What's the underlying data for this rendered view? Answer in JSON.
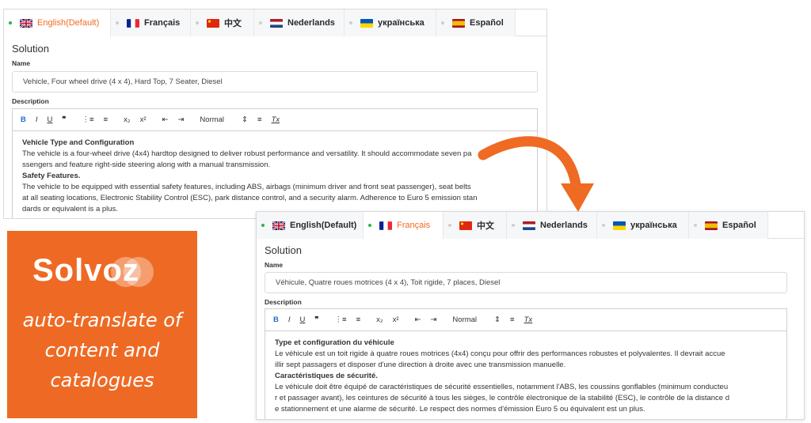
{
  "colors": {
    "accent": "#f26a21",
    "active_dot": "#2db34a",
    "promo_bg": "#ee6a24",
    "arrow": "#ef6a23"
  },
  "tabs": [
    {
      "label": "English(Default)",
      "flag": "uk-flag-icon"
    },
    {
      "label": "Français",
      "flag": "france-flag-icon"
    },
    {
      "label": "中文",
      "flag": "china-flag-icon"
    },
    {
      "label": "Nederlands",
      "flag": "netherlands-flag-icon"
    },
    {
      "label": "українська",
      "flag": "ukraine-flag-icon"
    },
    {
      "label": "Español",
      "flag": "spain-flag-icon"
    }
  ],
  "toolbar": {
    "bold": "B",
    "italic": "I",
    "underline": "U",
    "quote": "❞",
    "ordered_list": "⋮≡",
    "bullet_list": "≡",
    "subscript": "x₂",
    "superscript": "x²",
    "outdent": "⇤",
    "indent": "⇥",
    "heading_select": "Normal",
    "select_arrow": "⇕",
    "align": "≡",
    "clear_format": "Tx"
  },
  "english": {
    "active_tab": "English(Default)",
    "section_title": "Solution",
    "name_label": "Name",
    "name_value": "Vehicle, Four wheel drive (4 x 4), Hard Top, 7 Seater, Diesel",
    "description_label": "Description",
    "content": {
      "heading1": "Vehicle Type and Configuration",
      "line1": "The vehicle is a four-wheel drive (4x4) hardtop designed to deliver robust performance and versatility. It should accommodate seven pa",
      "line2": "ssengers and feature right-side steering along with a manual transmission.",
      "heading2": "Safety Features.",
      "line3": "The vehicle to be equipped with essential safety features, including ABS, airbags (minimum driver and front seat passenger), seat belts",
      "line4": "at all seating locations, Electronic Stability Control (ESC), park distance control, and a security alarm. Adherence to Euro 5 emission stan",
      "line5": "dards or equivalent is a plus."
    }
  },
  "french": {
    "active_tab": "Français",
    "section_title": "Solution",
    "name_label": "Name",
    "name_value": "Véhicule, Quatre roues motrices (4 x 4), Toit rigide, 7 places, Diesel",
    "description_label": "Description",
    "content": {
      "heading1": "Type et configuration du véhicule",
      "line1": "Le véhicule est un toit rigide à quatre roues motrices (4x4) conçu pour offrir des performances robustes et polyvalentes. Il devrait accue",
      "line2": "illir sept passagers et disposer d'une direction à droite avec une transmission manuelle.",
      "heading2": "Caractéristiques de sécurité.",
      "line3": "Le véhicule doit être équipé de caractéristiques de sécurité essentielles, notamment l'ABS, les coussins gonflables (minimum conducteu",
      "line4": "r et passager avant), les ceintures de sécurité à tous les sièges, le contrôle électronique de la stabilité (ESC), le contrôle de la distance d",
      "line5": "e stationnement et une alarme de sécurité. Le respect des normes d'émission Euro 5 ou équivalent est un plus."
    }
  },
  "promo": {
    "logo": "Solvoz",
    "tagline1": "auto-translate of",
    "tagline2": "content and",
    "tagline3": "catalogues"
  }
}
